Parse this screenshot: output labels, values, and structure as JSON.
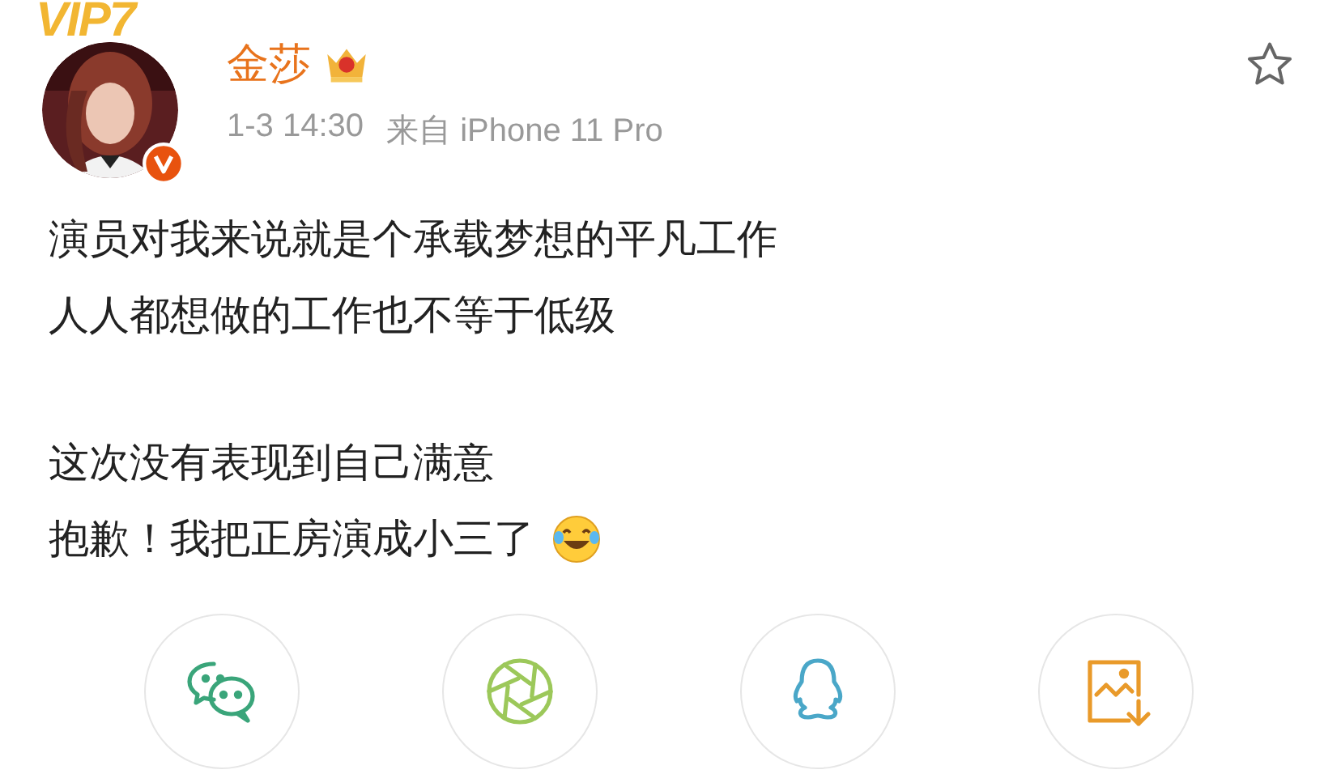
{
  "badge": {
    "text": "VIP7"
  },
  "author": {
    "name": "金莎",
    "verified": true,
    "crown": true
  },
  "meta": {
    "time": "1-3 14:30",
    "source": "来自 iPhone 11 Pro"
  },
  "favorite": {
    "selected": false
  },
  "post": {
    "paragraphs": [
      [
        "演员对我来说就是个承载梦想的平凡工作",
        "人人都想做的工作也不等于低级"
      ],
      [
        "这次没有表现到自己满意",
        "抱歉！我把正房演成小三了"
      ]
    ]
  },
  "share": [
    {
      "kind": "wechat"
    },
    {
      "kind": "moments"
    },
    {
      "kind": "qq"
    },
    {
      "kind": "save"
    }
  ]
}
